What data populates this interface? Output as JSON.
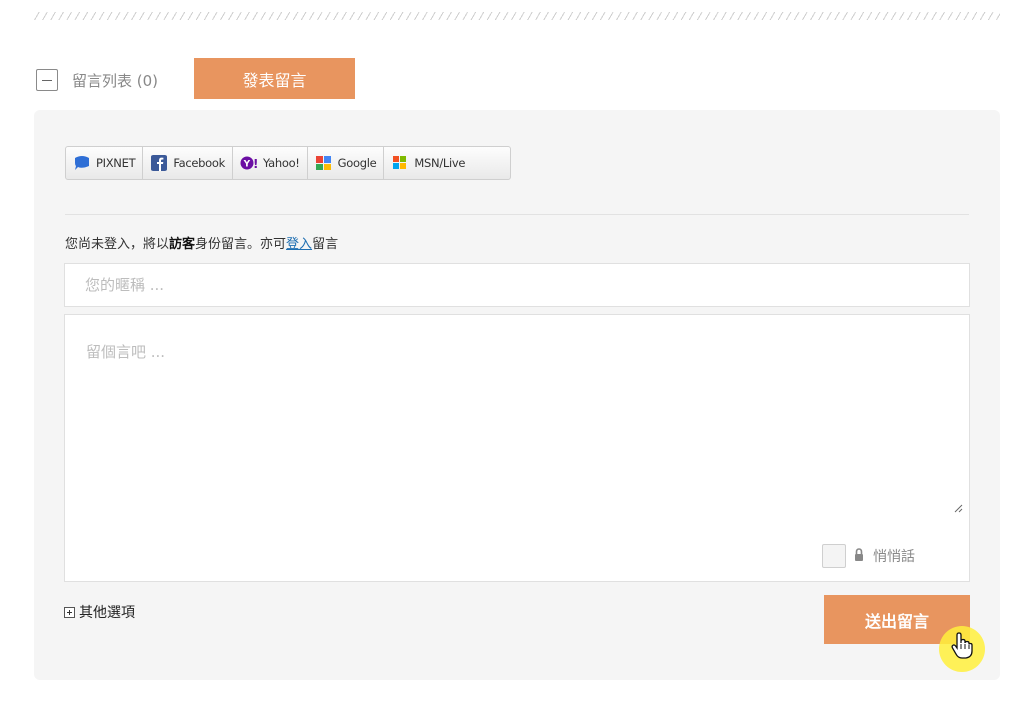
{
  "comments": {
    "list_label": "留言列表 (0)",
    "post_tab_label": "發表留言"
  },
  "login_providers": [
    {
      "name": "PIXNET",
      "icon": "pixnet-icon",
      "color": "#2f6fd6"
    },
    {
      "name": "Facebook",
      "icon": "facebook-icon",
      "color": "#3b5998"
    },
    {
      "name": "Yahoo!",
      "icon": "yahoo-icon",
      "color": "#6b0ea3"
    },
    {
      "name": "Google",
      "icon": "google-icon",
      "color": "#4285f4"
    },
    {
      "name": "MSN/Live",
      "icon": "msn-icon",
      "color": "#f25022"
    }
  ],
  "guest_notice": {
    "prefix": "您尚未登入，將以",
    "role": "訪客",
    "middle": "身份留言。亦可",
    "login_link": "登入",
    "suffix": "留言"
  },
  "form": {
    "nickname_placeholder": "您的暱稱 ...",
    "message_placeholder": "留個言吧 ...",
    "secret_label": "悄悄話",
    "more_options_label": "其他選項",
    "submit_label": "送出留言"
  },
  "colors": {
    "accent": "#e8955f",
    "panel_bg": "#f5f5f5",
    "link": "#1f6fb2"
  }
}
